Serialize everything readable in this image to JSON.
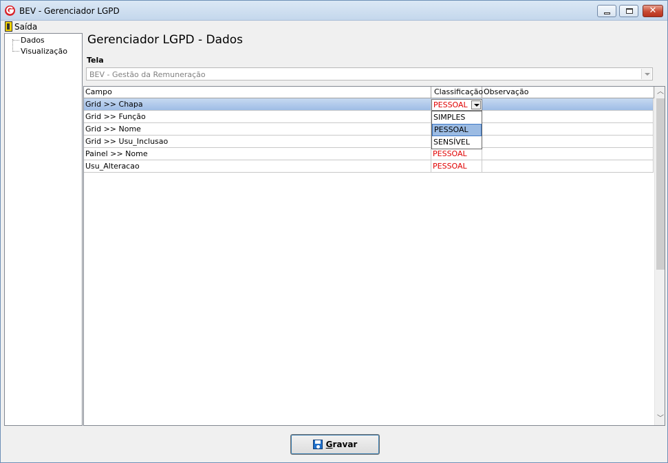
{
  "window": {
    "title": "BEV - Gerenciador LGPD",
    "controls": {
      "minimize": "minimize",
      "maximize": "maximize",
      "close": "✕"
    }
  },
  "menu": {
    "exit_label": "Saída"
  },
  "tree": {
    "items": [
      "Dados",
      "Visualização"
    ]
  },
  "page": {
    "title": "Gerenciador LGPD - Dados",
    "tela_label": "Tela",
    "tela_value": "BEV - Gestão da Remuneração"
  },
  "grid": {
    "columns": [
      "Campo",
      "Classificação",
      "Observação"
    ],
    "rows": [
      {
        "campo": "Grid >> Chapa",
        "classificacao": "PESSOAL",
        "observacao": ""
      },
      {
        "campo": "Grid >> Função",
        "classificacao": "",
        "observacao": ""
      },
      {
        "campo": "Grid >> Nome",
        "classificacao": "",
        "observacao": ""
      },
      {
        "campo": "Grid >> Usu_Inclusao",
        "classificacao": "",
        "observacao": ""
      },
      {
        "campo": "Painel >> Nome",
        "classificacao": "PESSOAL",
        "observacao": ""
      },
      {
        "campo": "Usu_Alteracao",
        "classificacao": "PESSOAL",
        "observacao": ""
      }
    ],
    "editor_value": "PESSOAL",
    "dropdown_options": [
      "SIMPLES",
      "PESSOAL",
      "SENSÍVEL"
    ],
    "dropdown_highlighted": "PESSOAL"
  },
  "footer": {
    "save_first_letter": "G",
    "save_rest": "ravar"
  },
  "colors": {
    "classification_text": "#e00000",
    "selected_row": "#9fbde6",
    "dropdown_highlight": "#9bbbe3"
  }
}
